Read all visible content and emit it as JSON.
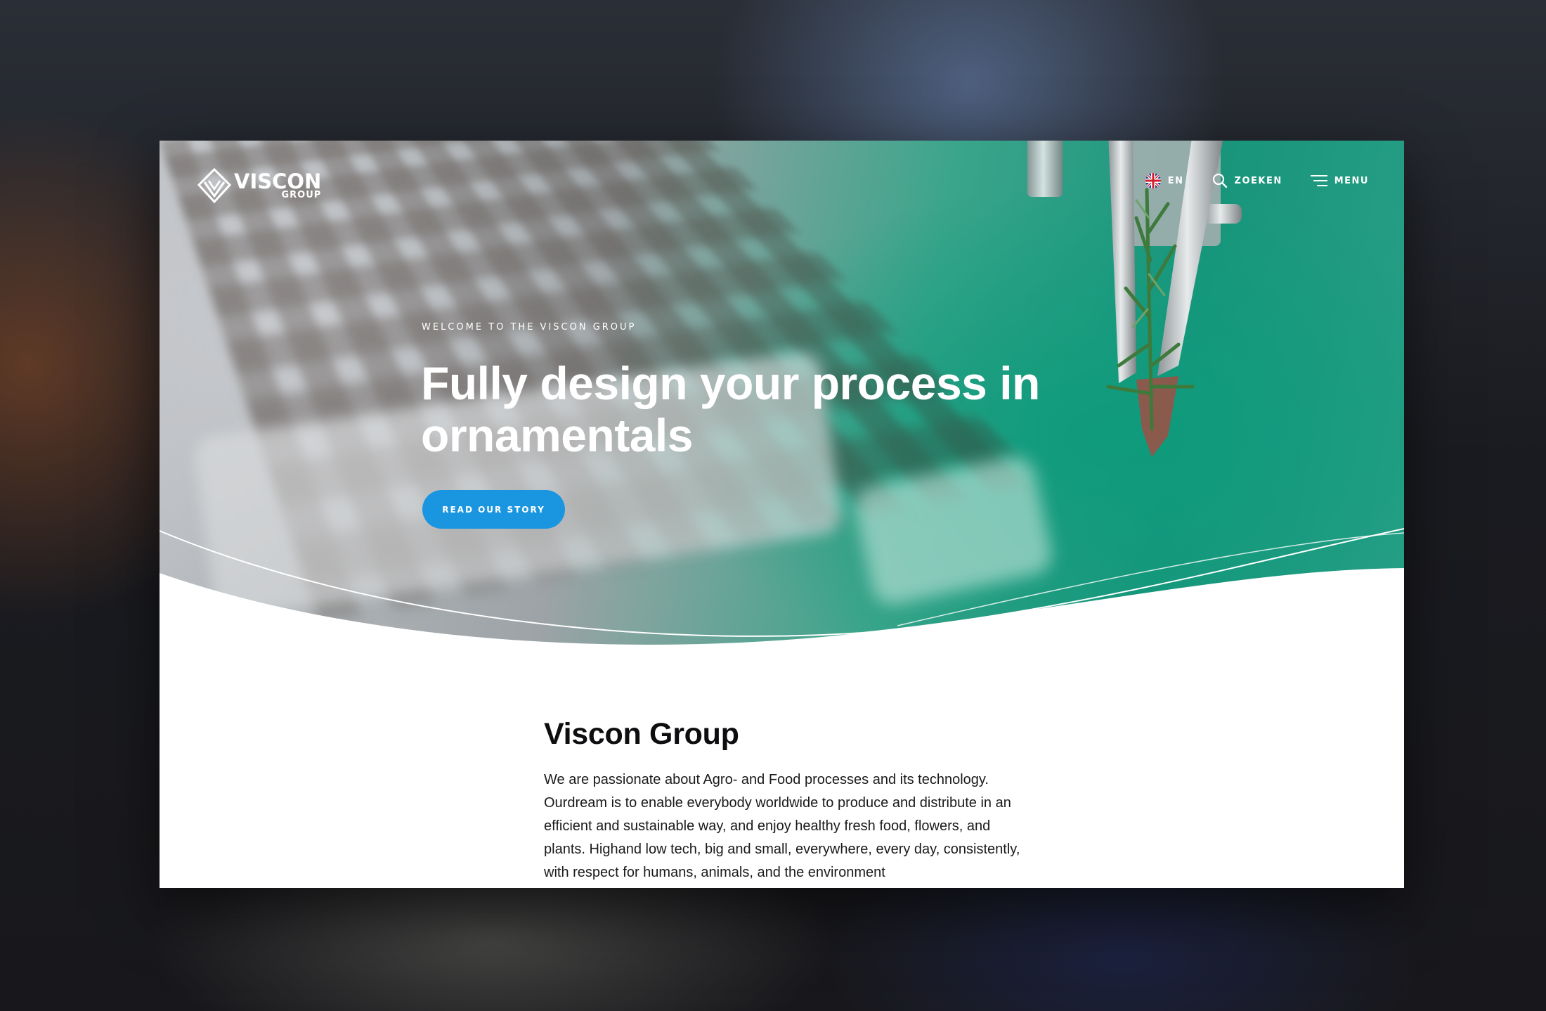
{
  "brand": {
    "name": "VISCON",
    "sub": "GROUP",
    "logo_icon": "viscon-logo-mark"
  },
  "nav": {
    "language": "EN",
    "language_icon": "uk-flag-icon",
    "search_label": "ZOEKEN",
    "search_icon": "search-icon",
    "menu_label": "MENU",
    "menu_icon": "menu-icon"
  },
  "hero": {
    "eyebrow": "WELCOME TO THE VISCON GROUP",
    "headline": "Fully design your process in ornamentals",
    "cta_label": "READ OUR STORY"
  },
  "section": {
    "title": "Viscon Group",
    "body": "We are passionate about Agro- and Food processes and its technology. Ourdream is to enable everybody worldwide to produce and distribute in an efficient and sustainable way, and enjoy healthy fresh food, flowers, and plants. Highand low tech, big and small, everywhere, every day, consistently, with respect for humans, animals, and the environment"
  },
  "colors": {
    "accent_button": "#1a95e0",
    "hero_green": "#0f9b7c",
    "text_dark": "#0e0e10",
    "background_white": "#ffffff"
  }
}
